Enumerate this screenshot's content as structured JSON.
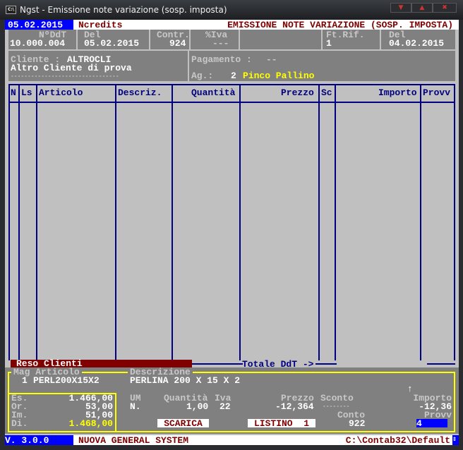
{
  "window": {
    "title": "Ngst - Emissione note variazione (sosp. imposta)",
    "icon": "console-icon",
    "buttons": [
      "minimize",
      "maximize",
      "close"
    ]
  },
  "top": {
    "date": "05.02.2015",
    "module": "Ncredits",
    "heading": "EMISSIONE NOTE VARIAZIONE (SOSP. IMPOSTA)"
  },
  "doc": {
    "ndt_label": "NºDdT",
    "ndt": "10.000.004",
    "del_label": "Del",
    "del": "05.02.2015",
    "contr_label": "Contr.",
    "contr": "924",
    "iva_label": "%Iva",
    "iva": "---",
    "ftrif_label": "Ft.Rif.",
    "ftrif": "1",
    "del2_label": "Del",
    "del2": "04.02.2015"
  },
  "client": {
    "label": "Cliente :",
    "code": "ALTROCLI",
    "name": "Altro Cliente di prova",
    "dots": "--------------------------------",
    "pay_label": "Pagamento :",
    "pay": "--",
    "ag_label": "Ag.:",
    "ag_num": "2",
    "ag_name": "Pinco Pallino"
  },
  "table": {
    "columns": [
      "N",
      "Ls",
      "Articolo",
      "Descriz.",
      "Quantità",
      "Prezzo",
      "Sc",
      "Importo",
      "Provv"
    ],
    "rows": []
  },
  "footer": {
    "causale": "Reso Clienti",
    "totale": "Totale DdT ->"
  },
  "detail": {
    "mag_label": "Mag Articolo",
    "mag": "1",
    "articolo": "PERL200X15X2",
    "desc_label": "Descrizione",
    "desc": "PERLINA 200 X 15 X 2",
    "stock": [
      {
        "label": "Es.",
        "value": "1.466,00"
      },
      {
        "label": "Or.",
        "value": "53,00"
      },
      {
        "label": "Im.",
        "value": "51,00"
      },
      {
        "label": "Di.",
        "value": "1.468,00"
      }
    ],
    "um_label": "UM",
    "um": "N.",
    "qta_label": "Quantità",
    "qta": "1,00",
    "iva_label": "Iva",
    "iva": "22",
    "prezzo_label": "Prezzo",
    "prezzo": "-12,364",
    "sconto_label": "Sconto",
    "sconto": "--------",
    "importo_label": "Importo",
    "importo": "-12,36",
    "conto_label": "Conto",
    "conto": "922",
    "provv_label": "Provv",
    "provv": "4",
    "scarica": "SCARICA",
    "listino": "LISTINO  1",
    "arrow": "↑"
  },
  "status": {
    "version": "V. 3.0.0",
    "company": "NUOVA GENERAL SYSTEM",
    "path": "C:\\Contab32\\Default"
  },
  "colors": {
    "blue": "#0000ff",
    "darkred": "#800000",
    "yellow": "#ffff00",
    "grey": "#808080",
    "light": "#c0c0c0"
  }
}
